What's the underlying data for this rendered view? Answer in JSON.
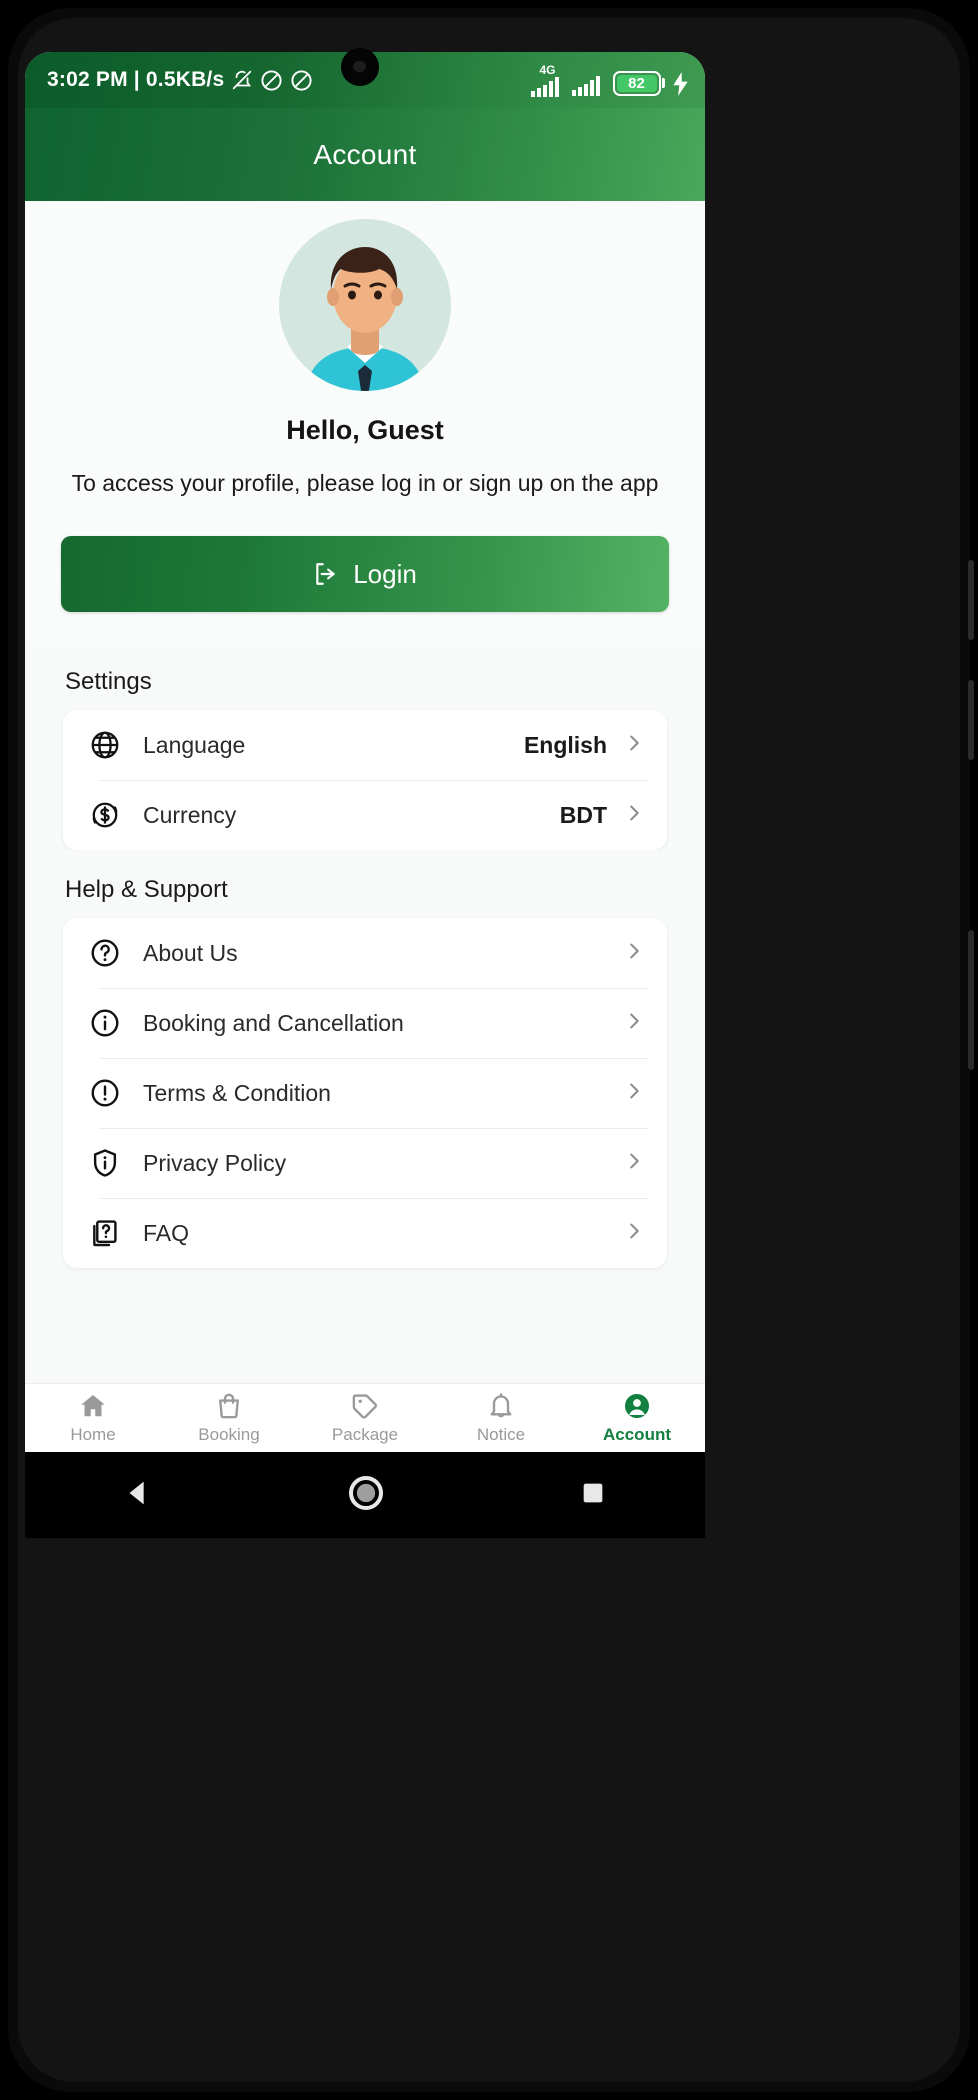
{
  "status_bar": {
    "clock": "3:02 PM | 0.5KB/s",
    "icons": [
      "bell-muted-icon",
      "do-not-disturb-icon",
      "do-not-disturb-icon"
    ],
    "network_label": "4G",
    "signal_icons": [
      "signal-bars-icon",
      "signal-bars-icon"
    ],
    "battery_percent": "82",
    "charging_icon": "charging-bolt-icon"
  },
  "app_bar": {
    "title": "Account"
  },
  "profile": {
    "avatar_icon": "user-avatar",
    "greeting": "Hello, Guest",
    "subtitle": "To access your profile, please log in or sign up on the app",
    "login_label": "Login",
    "login_icon": "login-arrow-icon"
  },
  "settings": {
    "heading": "Settings",
    "rows": [
      {
        "icon": "globe-icon",
        "label": "Language",
        "value": "English"
      },
      {
        "icon": "currency-icon",
        "label": "Currency",
        "value": "BDT"
      }
    ]
  },
  "help": {
    "heading": "Help & Support",
    "rows": [
      {
        "icon": "question-circle-icon",
        "label": "About Us"
      },
      {
        "icon": "info-circle-icon",
        "label": "Booking and Cancellation"
      },
      {
        "icon": "exclamation-circle-icon",
        "label": "Terms & Condition"
      },
      {
        "icon": "shield-info-icon",
        "label": "Privacy Policy"
      },
      {
        "icon": "faq-icon",
        "label": "FAQ"
      }
    ]
  },
  "bottom_nav": {
    "items": [
      {
        "icon": "home-icon",
        "label": "Home",
        "active": false
      },
      {
        "icon": "bag-icon",
        "label": "Booking",
        "active": false
      },
      {
        "icon": "tag-icon",
        "label": "Package",
        "active": false
      },
      {
        "icon": "bell-icon",
        "label": "Notice",
        "active": false
      },
      {
        "icon": "account-icon",
        "label": "Account",
        "active": true
      }
    ]
  },
  "android_nav": {
    "back_icon": "triangle-back-icon",
    "home_icon": "circle-home-icon",
    "recents_icon": "square-recents-icon"
  },
  "colors": {
    "brand_dark": "#0f6430",
    "brand_light": "#49a85b",
    "accent": "#118040",
    "battery": "#44c767",
    "page_bg": "#f7faf8"
  }
}
